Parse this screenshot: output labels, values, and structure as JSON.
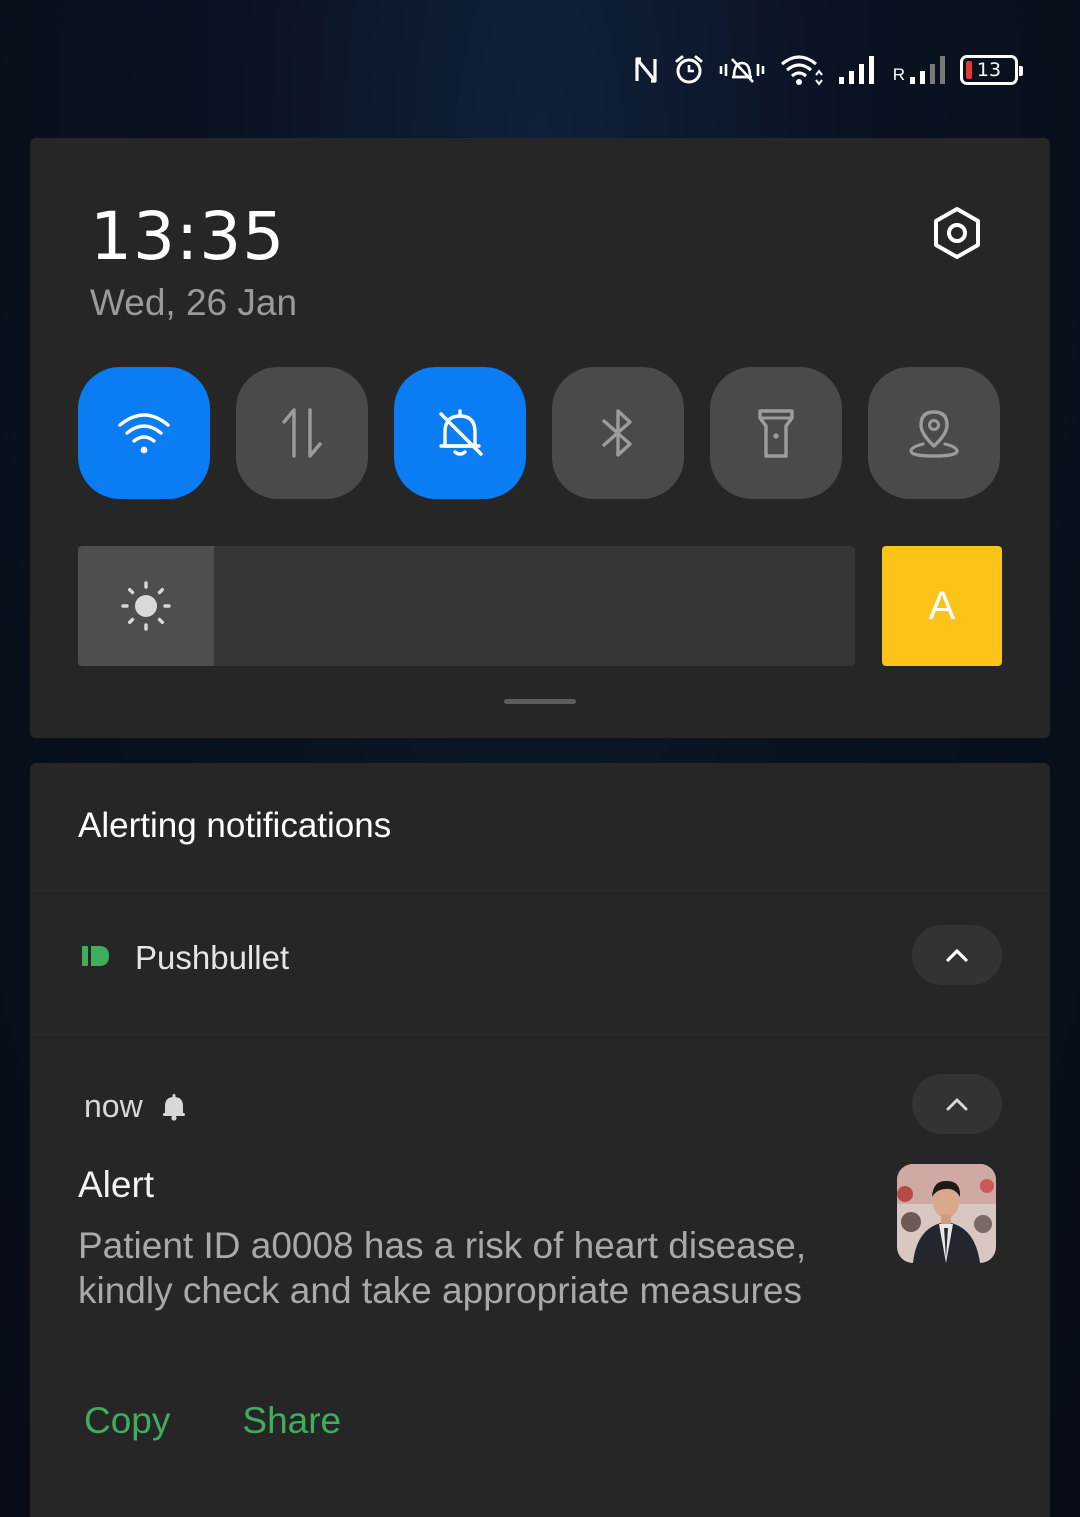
{
  "status_bar": {
    "icons": [
      "nfc-icon",
      "alarm-icon",
      "vibrate-mute-icon",
      "wifi-icon",
      "signal-icon",
      "roaming-signal-icon"
    ],
    "roaming_label": "R",
    "battery_level": "13",
    "battery_color": "#e53935"
  },
  "quick_settings": {
    "time": "13:35",
    "date": "Wed, 26 Jan",
    "tiles": [
      {
        "name": "wifi",
        "icon": "wifi-icon",
        "active": true
      },
      {
        "name": "mobile-data",
        "icon": "data-arrows-icon",
        "active": false
      },
      {
        "name": "do-not-disturb",
        "icon": "bell-off-icon",
        "active": true
      },
      {
        "name": "bluetooth",
        "icon": "bluetooth-icon",
        "active": false
      },
      {
        "name": "flashlight",
        "icon": "flashlight-icon",
        "active": false
      },
      {
        "name": "location",
        "icon": "location-icon",
        "active": false
      }
    ],
    "brightness_fraction": 0.175,
    "auto_brightness_label": "A",
    "accent_color": "#0a7df5",
    "auto_color": "#fcc419"
  },
  "notifications": {
    "section_title": "Alerting notifications",
    "app": {
      "name": "Pushbullet",
      "icon": "pushbullet-icon",
      "color": "#3fae5c"
    },
    "item": {
      "time": "now",
      "title": "Alert",
      "text": "Patient ID a0008 has a risk of heart disease, kindly check and take appropriate measures",
      "actions": [
        "Copy",
        "Share"
      ]
    }
  }
}
